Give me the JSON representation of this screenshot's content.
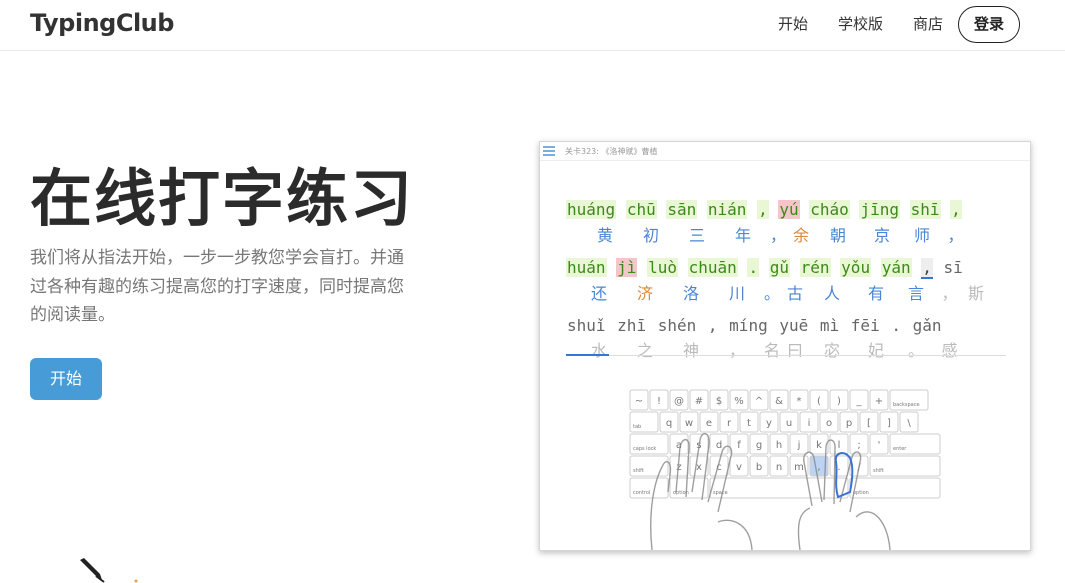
{
  "header": {
    "logo": "TypingClub",
    "nav": [
      "开始",
      "学校版",
      "商店"
    ],
    "login": "登录"
  },
  "hero": {
    "title": "在线打字练习",
    "description": "我们将从指法开始，一步一步教您学会盲打。并通过各种有趣的练习提高您的打字速度，同时提高您的阅读量。",
    "start_button": "开始"
  },
  "preview": {
    "title": "关卡323: 《洛神赋》曹植",
    "line1_pinyin": [
      {
        "t": "huáng",
        "s": "done"
      },
      {
        "t": "chū",
        "s": "done"
      },
      {
        "t": "sān",
        "s": "done"
      },
      {
        "t": "nián",
        "s": "done"
      },
      {
        "t": ",",
        "s": "done"
      },
      {
        "t": "yú",
        "s": "err"
      },
      {
        "t": "cháo",
        "s": "done"
      },
      {
        "t": "jīng",
        "s": "done"
      },
      {
        "t": "shī",
        "s": "done"
      },
      {
        "t": ",",
        "s": "done"
      }
    ],
    "line1_hanzi": [
      "黄",
      "初",
      "三",
      "年",
      "，",
      "余",
      "朝",
      "京",
      "师",
      "，"
    ],
    "line2_pinyin": [
      {
        "t": "huán",
        "s": "done"
      },
      {
        "t": "jì",
        "s": "err"
      },
      {
        "t": "luò",
        "s": "done"
      },
      {
        "t": "chuān",
        "s": "done"
      },
      {
        "t": ".",
        "s": "done"
      },
      {
        "t": "gǔ",
        "s": "done"
      },
      {
        "t": "rén",
        "s": "done"
      },
      {
        "t": "yǒu",
        "s": "done"
      },
      {
        "t": "yán",
        "s": "done"
      },
      {
        "t": ",",
        "s": "cur"
      },
      {
        "t": "sī",
        "s": "todo"
      }
    ],
    "line2_hanzi": [
      "还",
      "济",
      "洛",
      "川",
      "。",
      "古",
      "人",
      "有",
      "言",
      "，",
      "斯"
    ],
    "line3_pinyin": [
      {
        "t": "shuǐ",
        "s": "todo"
      },
      {
        "t": "zhī",
        "s": "todo"
      },
      {
        "t": "shén",
        "s": "todo"
      },
      {
        "t": ",",
        "s": "todo"
      },
      {
        "t": "míng",
        "s": "todo"
      },
      {
        "t": "yuē",
        "s": "todo"
      },
      {
        "t": "mì",
        "s": "todo"
      },
      {
        "t": "fēi",
        "s": "todo"
      },
      {
        "t": ".",
        "s": "todo"
      },
      {
        "t": "gǎn",
        "s": "todo"
      }
    ],
    "line3_hanzi": [
      "水",
      "之",
      "神",
      "，",
      "名",
      "曰",
      "宓",
      "妃",
      "。",
      "感"
    ],
    "keyboard_rows": [
      [
        "~",
        "!",
        "@",
        "#",
        "$",
        "%",
        "^",
        "&",
        "*",
        "(",
        ")",
        "_",
        "+",
        "backspace"
      ],
      [
        "tab",
        "q",
        "w",
        "e",
        "r",
        "t",
        "y",
        "u",
        "i",
        "o",
        "p",
        "[",
        "]",
        "\\"
      ],
      [
        "caps lock",
        "a",
        "s",
        "d",
        "f",
        "g",
        "h",
        "j",
        "k",
        "l",
        ";",
        "'",
        "enter"
      ],
      [
        "shift",
        "z",
        "x",
        "c",
        "v",
        "b",
        "n",
        "m",
        ",",
        ".",
        "/",
        "shift"
      ],
      [
        "control",
        "option",
        "space",
        "option"
      ]
    ],
    "colors": {
      "done": "#3b8a1b",
      "error_bg": "#f4c6c9",
      "done_bg": "#eaf7d4",
      "accent": "#479bd6"
    }
  }
}
